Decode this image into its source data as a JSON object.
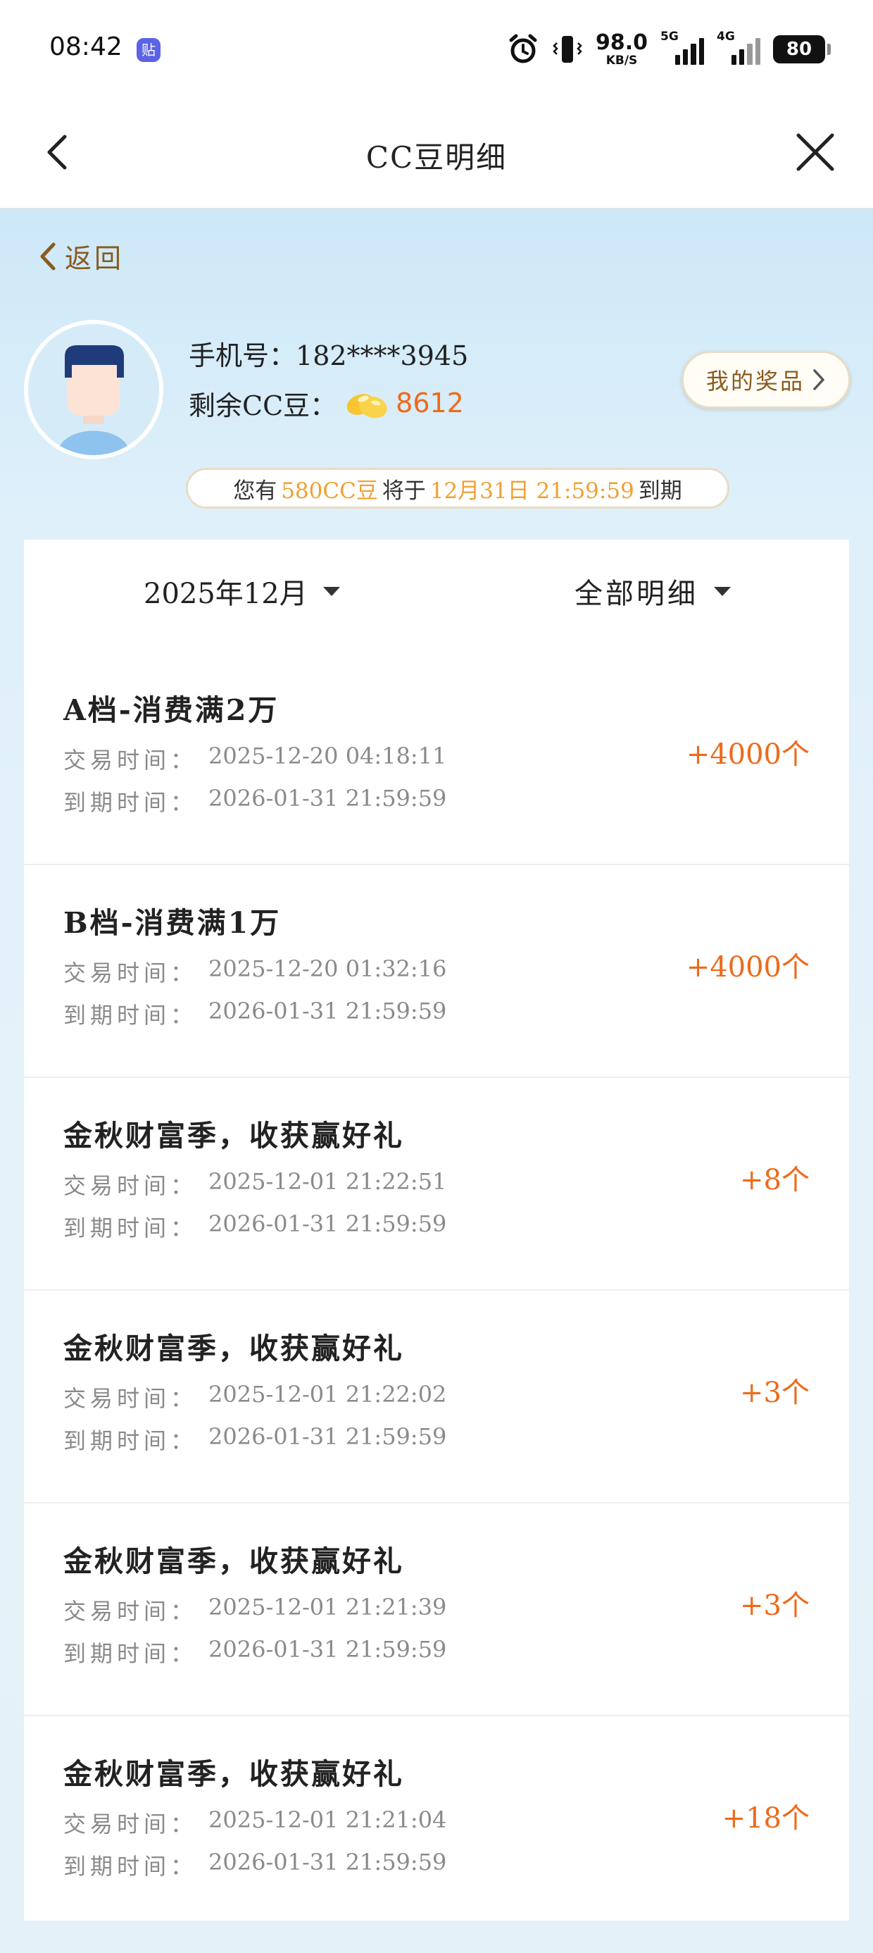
{
  "status_bar": {
    "time": "08:42",
    "app_badge": "贴",
    "net_speed_value": "98.0",
    "net_speed_unit": "KB/S",
    "sim1_label": "5G",
    "sim2_label": "4G",
    "battery": "80",
    "icons": [
      "alarm-icon",
      "vibrate-icon",
      "signal-icon",
      "battery-icon"
    ]
  },
  "nav": {
    "title": "CC豆明细",
    "back_icon": "chevron-left-icon",
    "close_icon": "close-icon"
  },
  "header": {
    "back_label": "返回",
    "phone_label": "手机号：",
    "phone_value": "182****3945",
    "balance_label": "剩余CC豆：",
    "balance_value": "8612",
    "prize_button": "我的奖品",
    "expire_notice": {
      "prefix": "您有",
      "amount": "580CC豆",
      "middle": "将于",
      "date": "12月31日 21:59:59",
      "suffix": "到期"
    }
  },
  "filters": {
    "month": "2025年12月",
    "type": "全部明细"
  },
  "labels": {
    "trade_time": "交易时间：",
    "expire_time": "到期时间："
  },
  "transactions": [
    {
      "title": "A档-消费满2万",
      "trade_time": "2025-12-20 04:18:11",
      "expire_time": "2026-01-31 21:59:59",
      "amount": "+4000个"
    },
    {
      "title": "B档-消费满1万",
      "trade_time": "2025-12-20 01:32:16",
      "expire_time": "2026-01-31 21:59:59",
      "amount": "+4000个"
    },
    {
      "title": "金秋财富季，收获赢好礼",
      "trade_time": "2025-12-01 21:22:51",
      "expire_time": "2026-01-31 21:59:59",
      "amount": "+8个"
    },
    {
      "title": "金秋财富季，收获赢好礼",
      "trade_time": "2025-12-01 21:22:02",
      "expire_time": "2026-01-31 21:59:59",
      "amount": "+3个"
    },
    {
      "title": "金秋财富季，收获赢好礼",
      "trade_time": "2025-12-01 21:21:39",
      "expire_time": "2026-01-31 21:59:59",
      "amount": "+3个"
    },
    {
      "title": "金秋财富季，收获赢好礼",
      "trade_time": "2025-12-01 21:21:04",
      "expire_time": "2026-01-31 21:59:59",
      "amount": "+18个"
    }
  ],
  "colors": {
    "accent_orange": "#ee6a1a",
    "highlight_gold": "#f0a030",
    "brown_text": "#8a5a1e",
    "background_blue": "#cde8f8"
  }
}
